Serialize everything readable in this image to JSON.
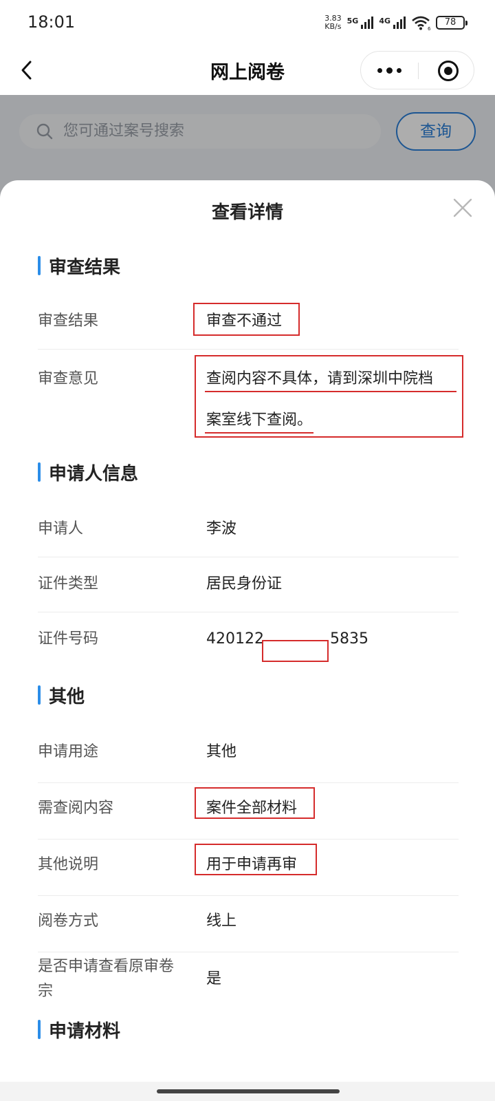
{
  "status_bar": {
    "time": "18:01",
    "net_speed_value": "3.83",
    "net_speed_unit": "KB/s",
    "sim1": "5G",
    "sim2": "4G",
    "wifi_badge": "6",
    "battery": "78"
  },
  "nav": {
    "title": "网上阅卷",
    "back_icon": "chevron-left-icon",
    "more_icon": "more-dots-icon",
    "close_icon": "target-circle-icon"
  },
  "search": {
    "placeholder": "您可通过案号搜索",
    "button_label": "查询"
  },
  "sheet": {
    "title": "查看详情",
    "close_icon": "close-icon",
    "sections": {
      "review": {
        "title": "审查结果",
        "result_label": "审查结果",
        "result_value": "审查不通过",
        "opinion_label": "审查意见",
        "opinion_line1": "查阅内容不具体，请到深圳中院档",
        "opinion_line2": "案室线下查阅。"
      },
      "applicant": {
        "title": "申请人信息",
        "name_label": "申请人",
        "name_value": "李波",
        "idtype_label": "证件类型",
        "idtype_value": "居民身份证",
        "idno_label": "证件号码",
        "idno_prefix": "420122",
        "idno_suffix": "5835"
      },
      "other": {
        "title": "其他",
        "purpose_label": "申请用途",
        "purpose_value": "其他",
        "content_label": "需查阅内容",
        "content_value": "案件全部材料",
        "note_label": "其他说明",
        "note_value": "用于申请再审",
        "mode_label": "阅卷方式",
        "mode_value": "线上",
        "original_label_line1": "是否申请查看原审卷",
        "original_label_line2": "宗",
        "original_value": "是"
      },
      "materials": {
        "title": "申请材料"
      }
    }
  },
  "colors": {
    "accent": "#2b8de8",
    "highlight_red": "#d52b2b"
  }
}
